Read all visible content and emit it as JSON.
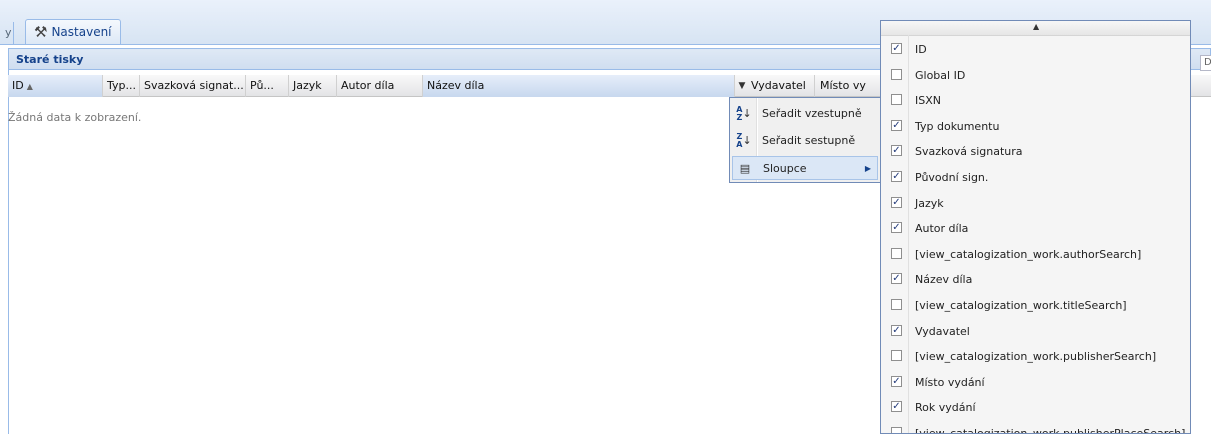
{
  "tabs": {
    "prev_fragment": "y",
    "active_label": "Nastavení"
  },
  "panel": {
    "title": "Staré tisky",
    "empty_text": "Žádná data k zobrazení.",
    "search_fragment": "D"
  },
  "columns": [
    "ID",
    "Typ...",
    "Svazková signat...",
    "Pů...",
    "Jazyk",
    "Autor díla",
    "Název díla",
    "Vydavatel",
    "Místo vy"
  ],
  "context_menu": {
    "items": [
      {
        "label": "Seřadit vzestupně",
        "icon": "sort-ascending-icon"
      },
      {
        "label": "Seřadit sestupně",
        "icon": "sort-descending-icon"
      },
      {
        "label": "Sloupce",
        "icon": "columns-icon"
      }
    ]
  },
  "columns_menu": {
    "items": [
      {
        "label": "ID",
        "checked": true
      },
      {
        "label": "Global ID",
        "checked": false
      },
      {
        "label": "ISXN",
        "checked": false
      },
      {
        "label": "Typ dokumentu",
        "checked": true
      },
      {
        "label": "Svazková signatura",
        "checked": true
      },
      {
        "label": "Původní sign.",
        "checked": true
      },
      {
        "label": "Jazyk",
        "checked": true
      },
      {
        "label": "Autor díla",
        "checked": true
      },
      {
        "label": "[view_catalogization_work.authorSearch]",
        "checked": false
      },
      {
        "label": "Název díla",
        "checked": true
      },
      {
        "label": "[view_catalogization_work.titleSearch]",
        "checked": false
      },
      {
        "label": "Vydavatel",
        "checked": true
      },
      {
        "label": "[view_catalogization_work.publisherSearch]",
        "checked": false
      },
      {
        "label": "Místo vydání",
        "checked": true
      },
      {
        "label": "Rok vydání",
        "checked": true
      },
      {
        "label": "[view_catalogization_work.publisherPlaceSearch]",
        "checked": false
      }
    ]
  },
  "colors": {
    "accent": "#15428b",
    "border": "#99bbe8",
    "menu_border": "#718bb7"
  }
}
